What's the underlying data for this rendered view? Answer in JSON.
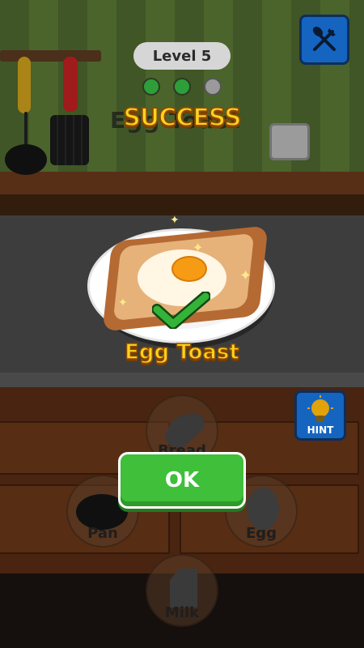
{
  "header": {
    "level_label": "Level 5",
    "progress_dots": [
      {
        "state": "complete",
        "color": "#2e9e3a"
      },
      {
        "state": "complete",
        "color": "#2e9e3a"
      },
      {
        "state": "incomplete",
        "color": "#9a9a9a"
      }
    ],
    "settings_icon": "fork-knife-icon"
  },
  "result": {
    "recipe_title_behind": "Egg Toast",
    "success_text": "SUCCESS",
    "food_name": "Egg Toast",
    "check_icon": "checkmark-icon"
  },
  "ingredients": [
    {
      "label": "Bread",
      "icon": "bread-icon"
    },
    {
      "label": "Pan",
      "icon": "pan-icon"
    },
    {
      "label": "Egg",
      "icon": "egg-icon"
    },
    {
      "label": "Milk",
      "icon": "milk-carton-icon"
    }
  ],
  "hint": {
    "label": "HINT",
    "icon": "lightbulb-icon"
  },
  "ok_button": {
    "label": "OK"
  },
  "colors": {
    "title_yellow": "#ffd21f",
    "ok_green": "#3fbf3a",
    "button_blue": "#1565c0"
  }
}
